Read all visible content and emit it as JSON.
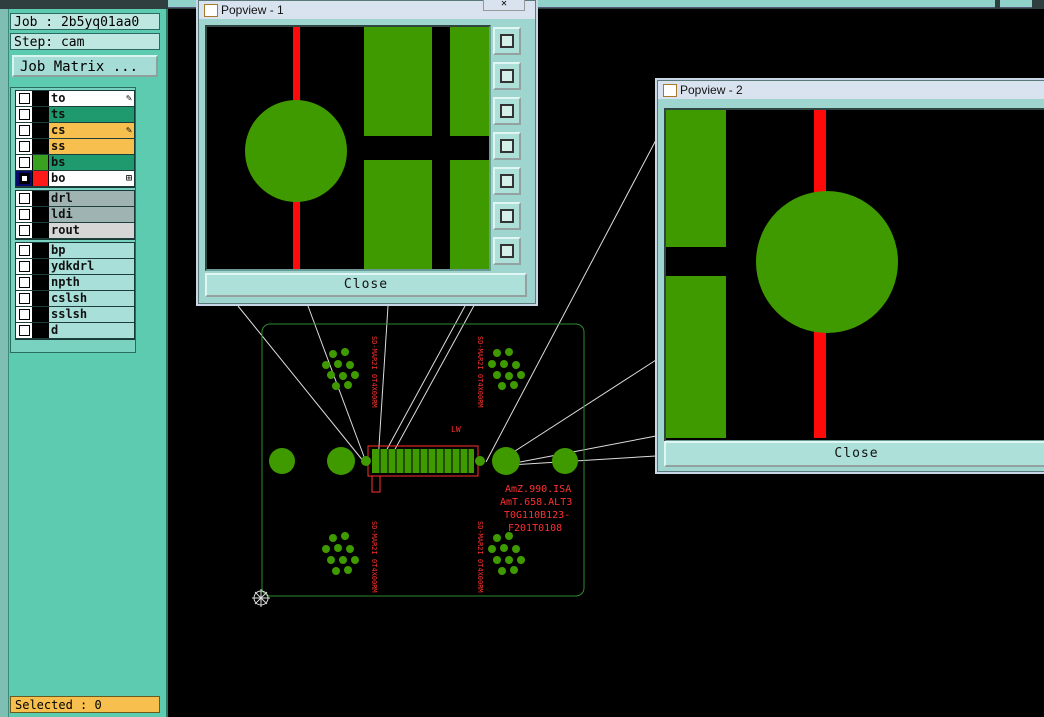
{
  "job_label": "Job : 2b5yq01aa0",
  "step_label": "Step: cam",
  "job_matrix_button": "Job Matrix ...",
  "layer_groups": [
    [
      {
        "name": "to",
        "color": "#ffffff",
        "swatch": "#000000",
        "mark": "✎"
      },
      {
        "name": "ts",
        "color": "#1f9a6e",
        "swatch": "#000000",
        "mark": ""
      },
      {
        "name": "cs",
        "color": "#f7bf4d",
        "swatch": "#000000",
        "mark": "✎"
      },
      {
        "name": "ss",
        "color": "#f7bf4d",
        "swatch": "#000000",
        "mark": ""
      },
      {
        "name": "bs",
        "color": "#1f9a6e",
        "swatch": "#3aa020",
        "mark": ""
      },
      {
        "name": "bo",
        "color": "#ffffff",
        "swatch": "#ff1a1a",
        "mark": "⊞",
        "selected": true
      }
    ],
    [
      {
        "name": "drl",
        "color": "#9fb3b3",
        "swatch": "#000000",
        "mark": ""
      },
      {
        "name": "ldi",
        "color": "#9fb3b3",
        "swatch": "#000000",
        "mark": ""
      },
      {
        "name": "rout",
        "color": "#d6d6d6",
        "swatch": "#000000",
        "mark": ""
      }
    ],
    [
      {
        "name": "bp",
        "color": "#a8dfd8",
        "swatch": "#000000",
        "mark": ""
      },
      {
        "name": "ydkdrl",
        "color": "#a8dfd8",
        "swatch": "#000000",
        "mark": ""
      },
      {
        "name": "npth",
        "color": "#a8dfd8",
        "swatch": "#000000",
        "mark": ""
      },
      {
        "name": "cslsh",
        "color": "#a8dfd8",
        "swatch": "#000000",
        "mark": ""
      },
      {
        "name": "sslsh",
        "color": "#a8dfd8",
        "swatch": "#000000",
        "mark": ""
      },
      {
        "name": "d",
        "color": "#a8dfd8",
        "swatch": "#000000",
        "mark": ""
      }
    ]
  ],
  "status_text": "Selected : 0",
  "popview1": {
    "title": "Popview - 1",
    "close_label": "Close"
  },
  "popview2": {
    "title": "Popview - 2",
    "close_label": "Close"
  },
  "board_text": {
    "lines": [
      "AmZ.990.ISA",
      "AmT.658.ALT3",
      "T0G110B123-",
      "F201T0108"
    ],
    "vertical": [
      "SD-MAR2I 0T4X00RM",
      "SD-MAR2I 0T4X00RM",
      "SD-MAR2I 0T4X00RM",
      "SD-MAR2I 0T4X00RM"
    ],
    "small_label": "LW"
  },
  "colors": {
    "copper": "#3f9a00",
    "trace": "#ff0a0a",
    "outline": "#2f8a2f",
    "silk": "#ff3030"
  }
}
